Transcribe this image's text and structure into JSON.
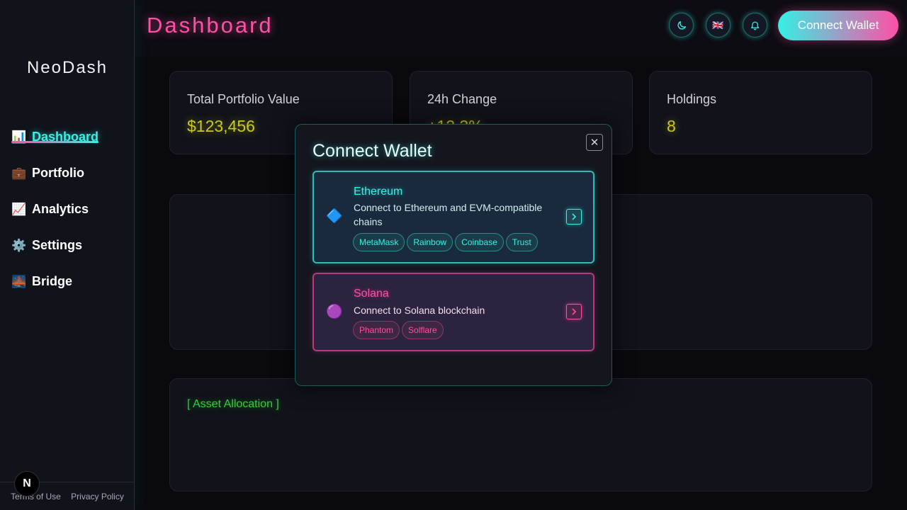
{
  "app": {
    "brand": "NeoDash",
    "page_title": "Dashboard"
  },
  "sidebar": {
    "items": [
      {
        "icon": "📊",
        "label": "Dashboard",
        "active": true
      },
      {
        "icon": "💼",
        "label": "Portfolio"
      },
      {
        "icon": "📈",
        "label": "Analytics"
      },
      {
        "icon": "⚙️",
        "label": "Settings"
      },
      {
        "icon": "🌉",
        "label": "Bridge"
      }
    ],
    "footer": {
      "terms": "Terms of Use",
      "privacy": "Privacy Policy"
    },
    "badge": "N"
  },
  "header": {
    "theme_icon": "moon-icon",
    "language_icon": "🇬🇧",
    "notification_icon": "bell-icon",
    "connect_label": "Connect Wallet"
  },
  "stats": [
    {
      "label": "Total Portfolio Value",
      "value": "$123,456"
    },
    {
      "label": "24h Change",
      "value": "+12.3%"
    },
    {
      "label": "Holdings",
      "value": "8"
    }
  ],
  "allocation": {
    "label": "[ Asset Allocation ]"
  },
  "modal": {
    "title": "Connect Wallet",
    "close_icon": "close-icon",
    "chains": [
      {
        "icon": "🔷",
        "name": "Ethereum",
        "description": "Connect to Ethereum and EVM-compatible chains",
        "wallets": [
          "MetaMask",
          "Rainbow",
          "Coinbase",
          "Trust"
        ]
      },
      {
        "icon": "🟣",
        "name": "Solana",
        "description": "Connect to Solana blockchain",
        "wallets": [
          "Phantom",
          "Solflare"
        ]
      }
    ]
  },
  "colors": {
    "cyan": "#35f0e4",
    "pink": "#ff4fa6",
    "yellow": "#f5f52a",
    "green": "#39ff3c"
  }
}
